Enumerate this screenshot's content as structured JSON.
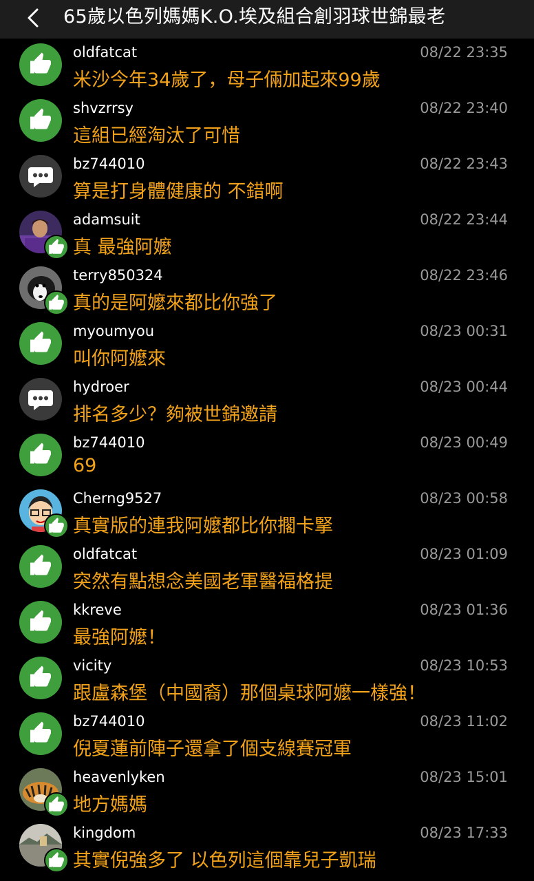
{
  "header": {
    "title": "65歲以色列媽媽K.O.埃及組合創羽球世錦最老",
    "back_icon": "chevron-left-icon"
  },
  "colors": {
    "like_green": "#3f9f3c",
    "comment_text": "#f1a21a",
    "timestamp": "#9a9a9a"
  },
  "comments": [
    {
      "user": "oldfatcat",
      "time": "08/22 23:35",
      "text": "米沙今年34歲了，母子倆加起來99歲",
      "avatar": "like"
    },
    {
      "user": "shvzrrsy",
      "time": "08/22 23:40",
      "text": "這組已經淘汰了可惜",
      "avatar": "like"
    },
    {
      "user": "bz744010",
      "time": "08/22 23:43",
      "text": "算是打身體健康的 不錯啊",
      "avatar": "comment"
    },
    {
      "user": "adamsuit",
      "time": "08/22 23:44",
      "text": "真 最強阿嬤",
      "avatar": "photo-purple"
    },
    {
      "user": "terry850324",
      "time": "08/22 23:46",
      "text": "真的是阿嬤來都比你強了",
      "avatar": "photo-dog"
    },
    {
      "user": "myoumyou",
      "time": "08/23 00:31",
      "text": "叫你阿嬤來",
      "avatar": "like"
    },
    {
      "user": "hydroer",
      "time": "08/23 00:44",
      "text": "排名多少？夠被世錦邀請",
      "avatar": "comment"
    },
    {
      "user": "bz744010",
      "time": "08/23 00:49",
      "text": "69",
      "avatar": "like"
    },
    {
      "user": "Cherng9527",
      "time": "08/23 00:58",
      "text": "真實版的連我阿嬤都比你擱卡掔",
      "avatar": "photo-cartoon"
    },
    {
      "user": "oldfatcat",
      "time": "08/23 01:09",
      "text": "突然有點想念美國老軍醫福格提",
      "avatar": "like"
    },
    {
      "user": "kkreve",
      "time": "08/23 01:36",
      "text": "最強阿嬤！",
      "avatar": "like"
    },
    {
      "user": "vicity",
      "time": "08/23 10:53",
      "text": "跟盧森堡（中國裔）那個桌球阿嬤一樣強！",
      "avatar": "like"
    },
    {
      "user": "bz744010",
      "time": "08/23 11:02",
      "text": "倪夏蓮前陣子還拿了個支線賽冠軍",
      "avatar": "like"
    },
    {
      "user": "heavenlyken",
      "time": "08/23 15:01",
      "text": "地方媽媽",
      "avatar": "photo-tiger"
    },
    {
      "user": "kingdom",
      "time": "08/23 17:33",
      "text": "其實倪強多了 以色列這個靠兒子凱瑞",
      "avatar": "photo-landscape"
    }
  ]
}
